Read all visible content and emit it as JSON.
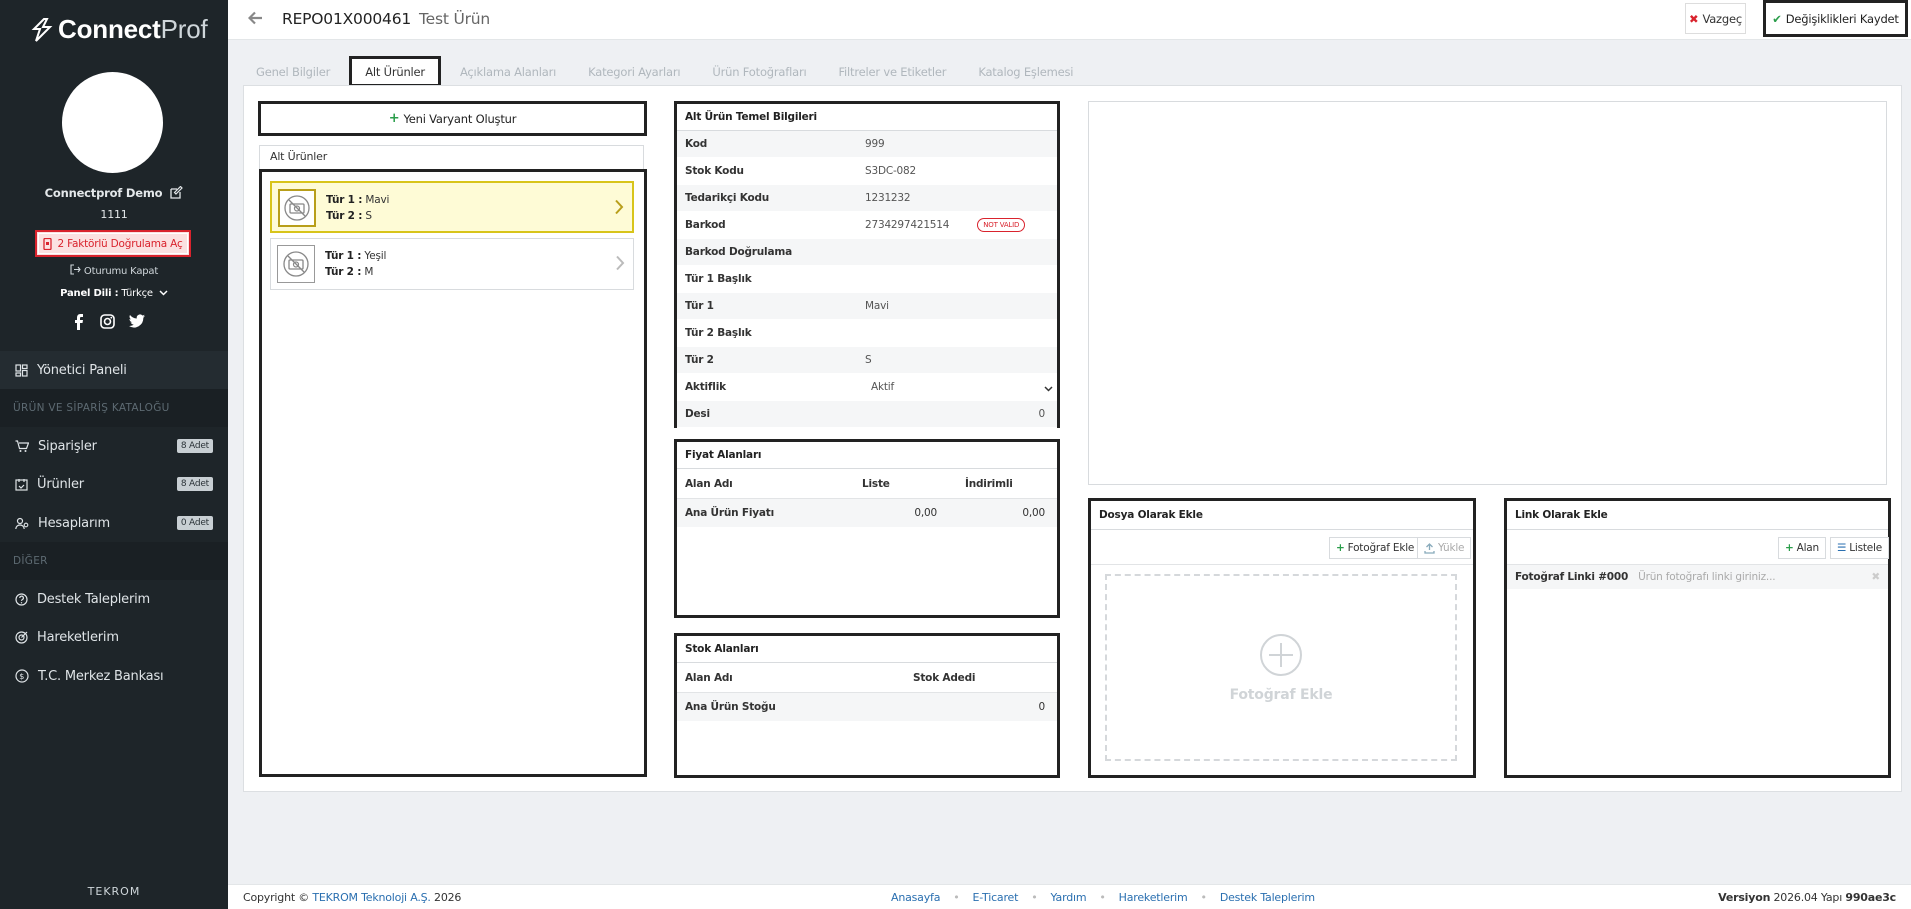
{
  "sidebar": {
    "logo_bold": "Connect",
    "logo_light": "Prof",
    "user_name": "Connectprof Demo",
    "user_code": "1111",
    "twofa_label": "2 Faktörlü Doğrulama Aç",
    "logout_label": "Oturumu Kapat",
    "lang_label": "Panel Dili :",
    "lang_value": "Türkçe",
    "dashboard": "Yönetici Paneli",
    "section_catalog": "ÜRÜN VE SİPARİŞ KATALOĞU",
    "orders": "Siparişler",
    "orders_badge": "8 Adet",
    "products": "Ürünler",
    "products_badge": "8 Adet",
    "accounts": "Hesaplarım",
    "accounts_badge": "0 Adet",
    "section_other": "DİĞER",
    "support": "Destek Taleplerim",
    "movements": "Hareketlerim",
    "bank": "T.C. Merkez Bankası",
    "brand_footer": "TEKROM"
  },
  "header": {
    "code": "REPO01X000461",
    "name": "Test Ürün",
    "cancel": "Vazgeç",
    "save": "Değişiklikleri Kaydet"
  },
  "tabs": [
    "Genel Bilgiler",
    "Alt Ürünler",
    "Açıklama Alanları",
    "Kategori Ayarları",
    "Ürün Fotoğrafları",
    "Filtreler ve Etiketler",
    "Katalog Eşlemesi"
  ],
  "variants": {
    "new_button": "Yeni Varyant Oluştur",
    "list_title": "Alt Ürünler",
    "items": [
      {
        "k1": "Tür 1 :",
        "v1": "Mavi",
        "k2": "Tür 2 :",
        "v2": "S"
      },
      {
        "k1": "Tür 1 :",
        "v1": "Yeşil",
        "k2": "Tür 2 :",
        "v2": "M"
      }
    ]
  },
  "basic": {
    "title": "Alt Ürün Temel Bilgileri",
    "kod_k": "Kod",
    "kod_v": "999",
    "stok_k": "Stok Kodu",
    "stok_v": "S3DC-082",
    "ted_k": "Tedarikçi Kodu",
    "ted_v": "1231232",
    "bar_k": "Barkod",
    "bar_v": "2734297421514",
    "bar_badge": "NOT VALID",
    "bard_k": "Barkod Doğrulama",
    "t1b_k": "Tür 1 Başlık",
    "t1_k": "Tür 1",
    "t1_v": "Mavi",
    "t2b_k": "Tür 2 Başlık",
    "t2_k": "Tür 2",
    "t2_v": "S",
    "akt_k": "Aktiflik",
    "akt_v": "Aktif",
    "desi_k": "Desi",
    "desi_v": "0"
  },
  "price": {
    "title": "Fiyat Alanları",
    "h1": "Alan Adı",
    "h2": "Liste",
    "h3": "İndirimli",
    "r_name": "Ana Ürün Fiyatı",
    "r_list": "0,00",
    "r_disc": "0,00"
  },
  "stock": {
    "title": "Stok Alanları",
    "h1": "Alan Adı",
    "h2": "Stok Adedi",
    "r_name": "Ana Ürün Stoğu",
    "r_val": "0"
  },
  "file": {
    "title": "Dosya Olarak Ekle",
    "add": "Fotoğraf Ekle",
    "upload": "Yükle",
    "drop": "Fotoğraf Ekle"
  },
  "link": {
    "title": "Link Olarak Ekle",
    "add": "Alan",
    "list": "Listele",
    "row_label": "Fotoğraf Linki #000",
    "placeholder": "Ürün fotoğrafı linki giriniz..."
  },
  "footer": {
    "copy": "Copyright ©",
    "company": "TEKROM Teknoloji A.Ş.",
    "year": "2026",
    "links": [
      "Anasayfa",
      "E-Ticaret",
      "Yardım",
      "Hareketlerim",
      "Destek Taleplerim"
    ],
    "ver_label": "Versiyon",
    "ver": "2026.04",
    "build_label": "Yapı",
    "build": "990ae3c"
  }
}
